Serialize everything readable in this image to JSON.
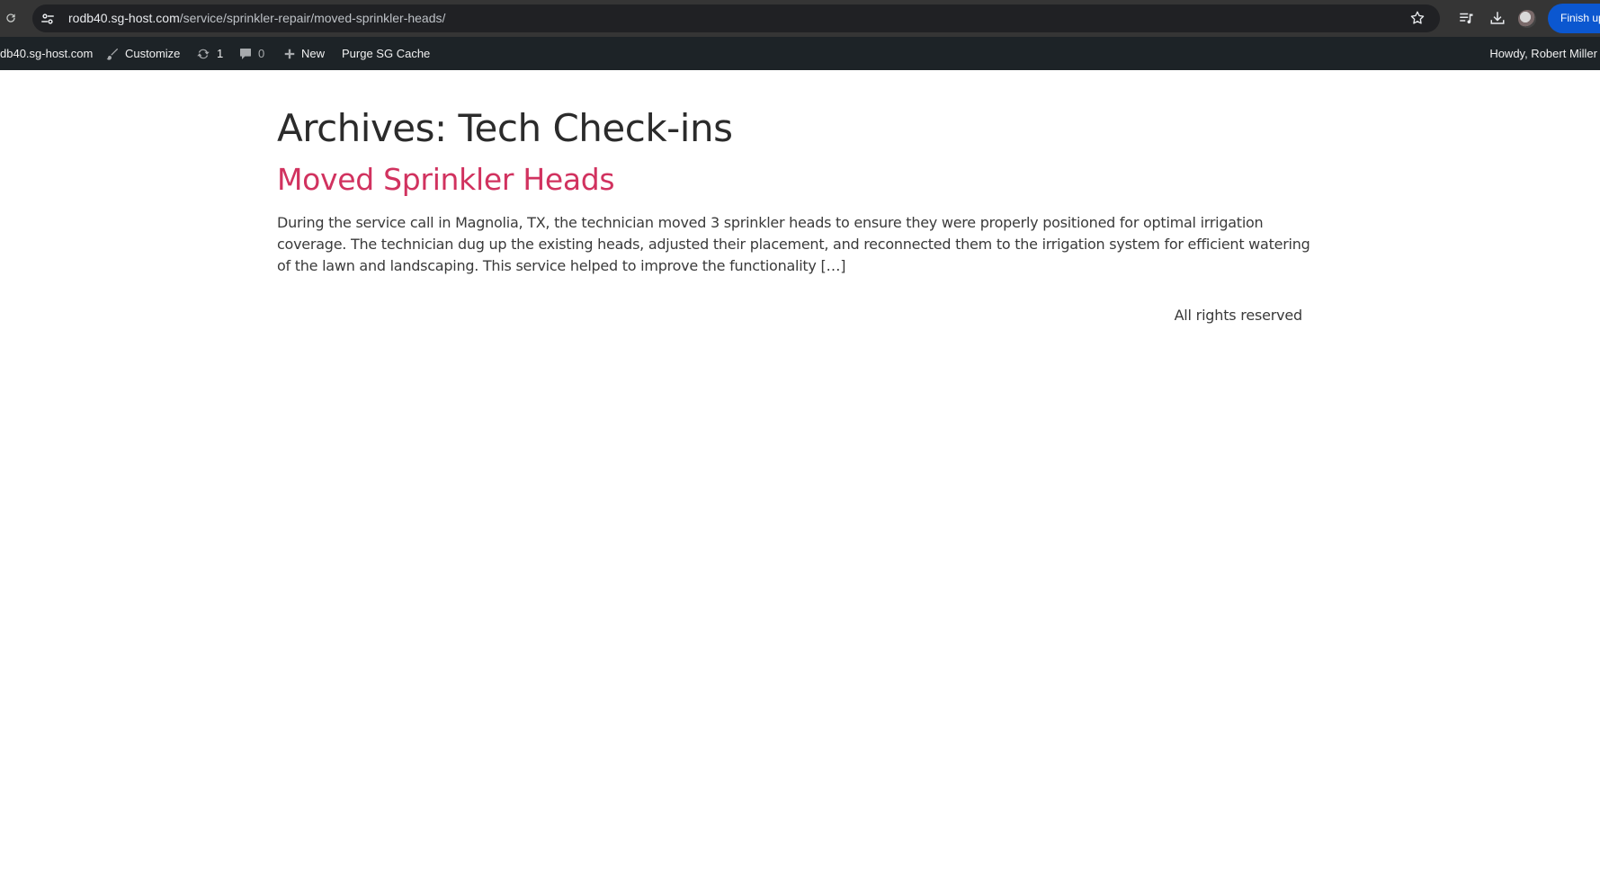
{
  "browser": {
    "url_domain": "rodb40.sg-host.com",
    "url_path": "/service/sprinkler-repair/moved-sprinkler-heads/",
    "finish_button_label": "Finish up"
  },
  "adminbar": {
    "site_name": "db40.sg-host.com",
    "customize_label": "Customize",
    "updates_count": "1",
    "comments_count": "0",
    "new_label": "New",
    "purge_label": "Purge SG Cache",
    "howdy_label": "Howdy, Robert Miller"
  },
  "main": {
    "archive_title": "Archives: Tech Check-ins",
    "post": {
      "title": "Moved Sprinkler Heads",
      "excerpt": "During the service call in Magnolia, TX, the technician moved 3 sprinkler heads to ensure they were properly positioned for optimal irrigation coverage. The technician dug up the existing heads, adjusted their placement, and reconnected them to the irrigation system for efficient watering of the lawn and landscaping. This service helped to improve the functionality […]"
    },
    "footer_text": "All rights reserved"
  },
  "colors": {
    "browser_bar": "#353535",
    "omnibox": "#202124",
    "adminbar": "#1d2327",
    "post_title": "#d1325f",
    "finish_button": "#0b57d0"
  },
  "icons": {
    "reload": "reload-icon",
    "site_info": "tune-icon",
    "bookmark": "star-icon",
    "media": "queue-music-icon",
    "downloads": "download-icon",
    "customize": "brush-icon",
    "updates": "refresh-icon",
    "comments": "comment-icon",
    "new": "plus-icon"
  }
}
